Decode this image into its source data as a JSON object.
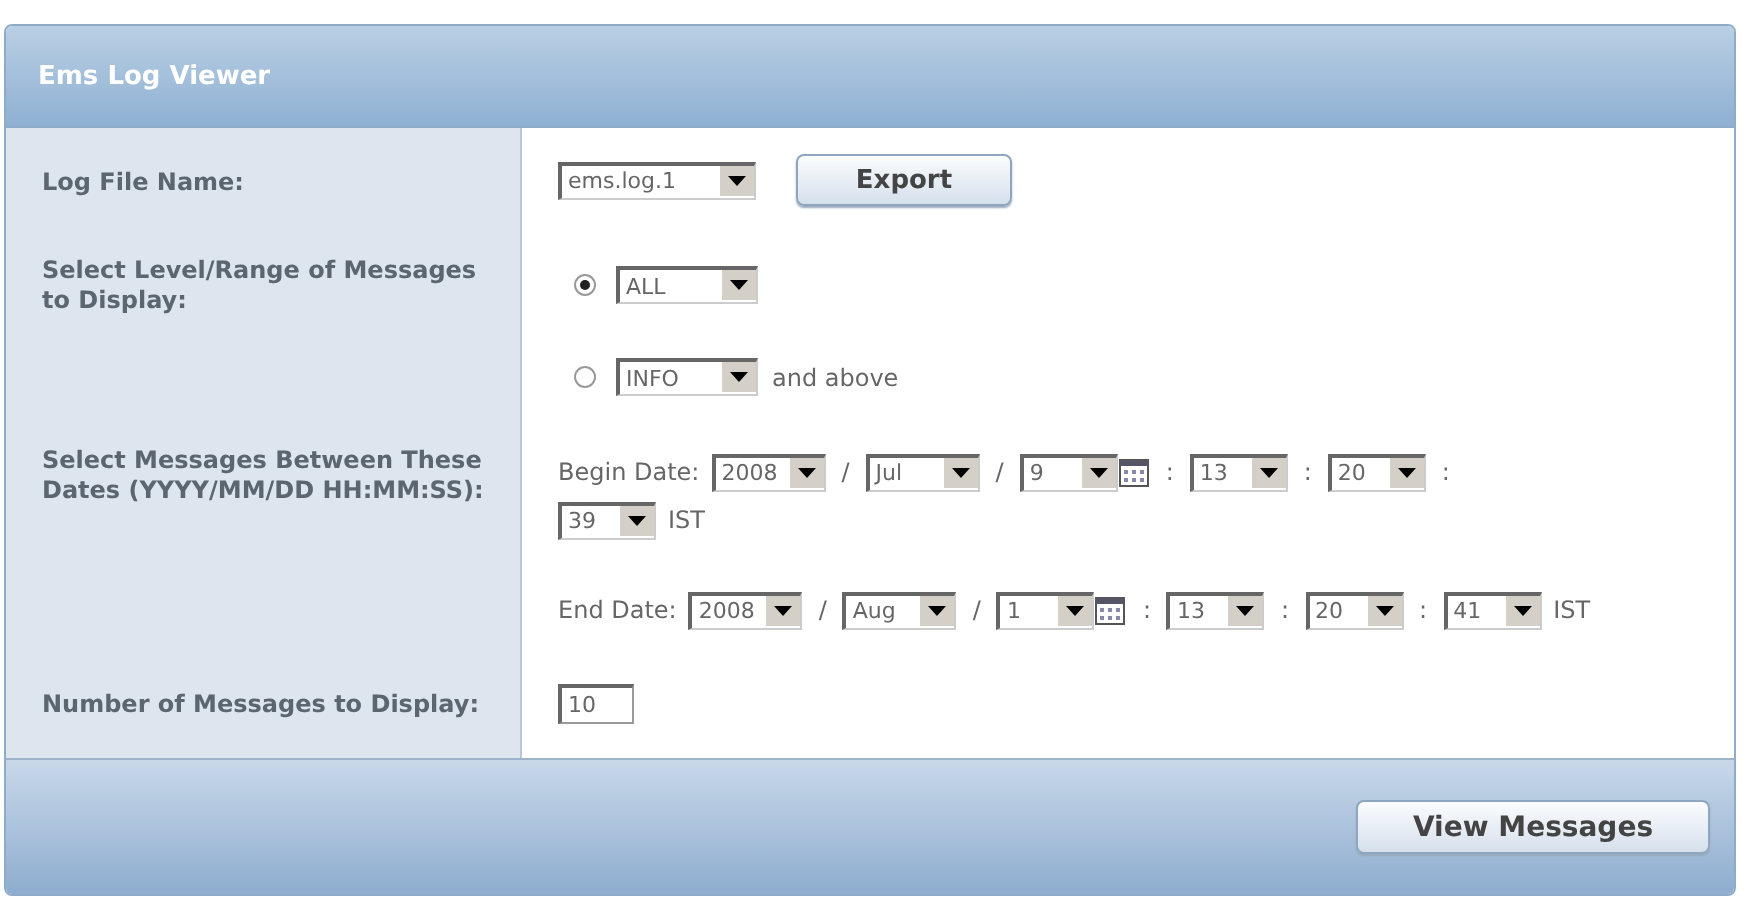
{
  "window": {
    "title": "Ems Log Viewer"
  },
  "log_file": {
    "label": "Log File Name:",
    "value": "ems.log.1",
    "button": "Export"
  },
  "level": {
    "label": "Select Level/Range of Messages to Display:",
    "options": [
      {
        "value": "ALL",
        "selected": true
      },
      {
        "value": "INFO",
        "selected": false,
        "suffix": "and above"
      }
    ]
  },
  "dates": {
    "label": "Select Messages Between These Dates (YYYY/MM/DD HH:MM:SS):",
    "ranges": [
      {
        "label": "Begin Date:",
        "lines": [
          [
            {
              "kind": "select",
              "value": "2008"
            },
            {
              "kind": "sep",
              "text": "/"
            },
            {
              "kind": "select",
              "value": "Jul"
            },
            {
              "kind": "sep",
              "text": "/"
            },
            {
              "kind": "select",
              "value": "9"
            },
            {
              "kind": "calendar"
            },
            {
              "kind": "sep",
              "text": ":"
            },
            {
              "kind": "select",
              "value": "13"
            },
            {
              "kind": "sep",
              "text": ":"
            },
            {
              "kind": "select",
              "value": "20"
            },
            {
              "kind": "sep",
              "text": ":"
            }
          ],
          [
            {
              "kind": "select",
              "value": "39"
            },
            {
              "kind": "text",
              "text": "IST"
            }
          ]
        ]
      },
      {
        "label": "End Date:",
        "lines": [
          [
            {
              "kind": "select",
              "value": "2008"
            },
            {
              "kind": "sep",
              "text": "/"
            },
            {
              "kind": "select",
              "value": "Aug"
            },
            {
              "kind": "sep",
              "text": "/"
            },
            {
              "kind": "select",
              "value": "1"
            },
            {
              "kind": "calendar"
            },
            {
              "kind": "sep",
              "text": ":"
            },
            {
              "kind": "select",
              "value": "13"
            },
            {
              "kind": "sep",
              "text": ":"
            },
            {
              "kind": "select",
              "value": "20"
            },
            {
              "kind": "sep",
              "text": ":"
            },
            {
              "kind": "select",
              "value": "41"
            },
            {
              "kind": "text",
              "text": "IST"
            }
          ]
        ]
      }
    ]
  },
  "count": {
    "label": "Number of Messages to Display:",
    "value": "10"
  },
  "footer": {
    "button": "View Messages"
  }
}
